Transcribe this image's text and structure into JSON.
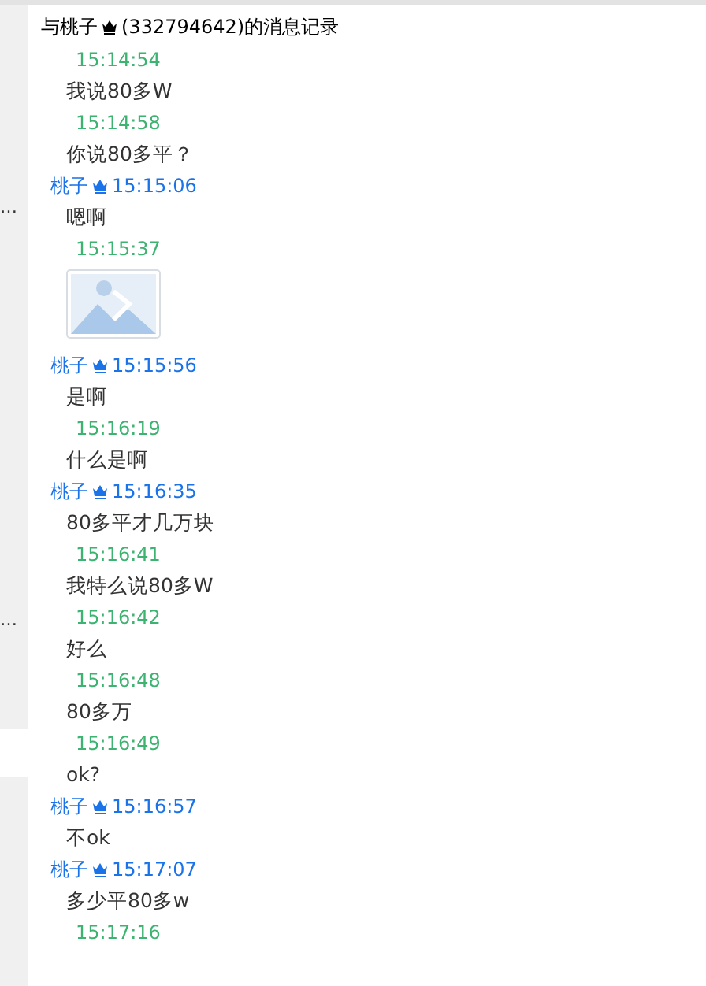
{
  "title": {
    "prefix": "与桃子",
    "suffix": "(332794642)的消息记录"
  },
  "sidebar": {
    "marks": [
      "…",
      "…"
    ]
  },
  "messages": [
    {
      "kind": "time",
      "text": "15:14:54"
    },
    {
      "kind": "text",
      "text": "我说80多W"
    },
    {
      "kind": "time",
      "text": "15:14:58"
    },
    {
      "kind": "text",
      "text": "你说80多平？"
    },
    {
      "kind": "sender",
      "name": "桃子",
      "time": "15:15:06"
    },
    {
      "kind": "text",
      "text": "嗯啊"
    },
    {
      "kind": "time",
      "text": "15:15:37"
    },
    {
      "kind": "image"
    },
    {
      "kind": "sender",
      "name": "桃子",
      "time": "15:15:56"
    },
    {
      "kind": "text",
      "text": "是啊"
    },
    {
      "kind": "time",
      "text": "15:16:19"
    },
    {
      "kind": "text",
      "text": "什么是啊"
    },
    {
      "kind": "sender",
      "name": "桃子",
      "time": "15:16:35"
    },
    {
      "kind": "text",
      "text": "80多平才几万块"
    },
    {
      "kind": "time",
      "text": "15:16:41"
    },
    {
      "kind": "text",
      "text": "我特么说80多W"
    },
    {
      "kind": "time",
      "text": "15:16:42"
    },
    {
      "kind": "text",
      "text": "好么"
    },
    {
      "kind": "time",
      "text": "15:16:48"
    },
    {
      "kind": "text",
      "text": "80多万"
    },
    {
      "kind": "time",
      "text": "15:16:49"
    },
    {
      "kind": "text",
      "text": "ok?"
    },
    {
      "kind": "sender",
      "name": "桃子",
      "time": "15:16:57"
    },
    {
      "kind": "text",
      "text": "不ok"
    },
    {
      "kind": "sender",
      "name": "桃子",
      "time": "15:17:07"
    },
    {
      "kind": "text",
      "text": "多少平80多w"
    },
    {
      "kind": "time",
      "text": "15:17:16"
    }
  ]
}
